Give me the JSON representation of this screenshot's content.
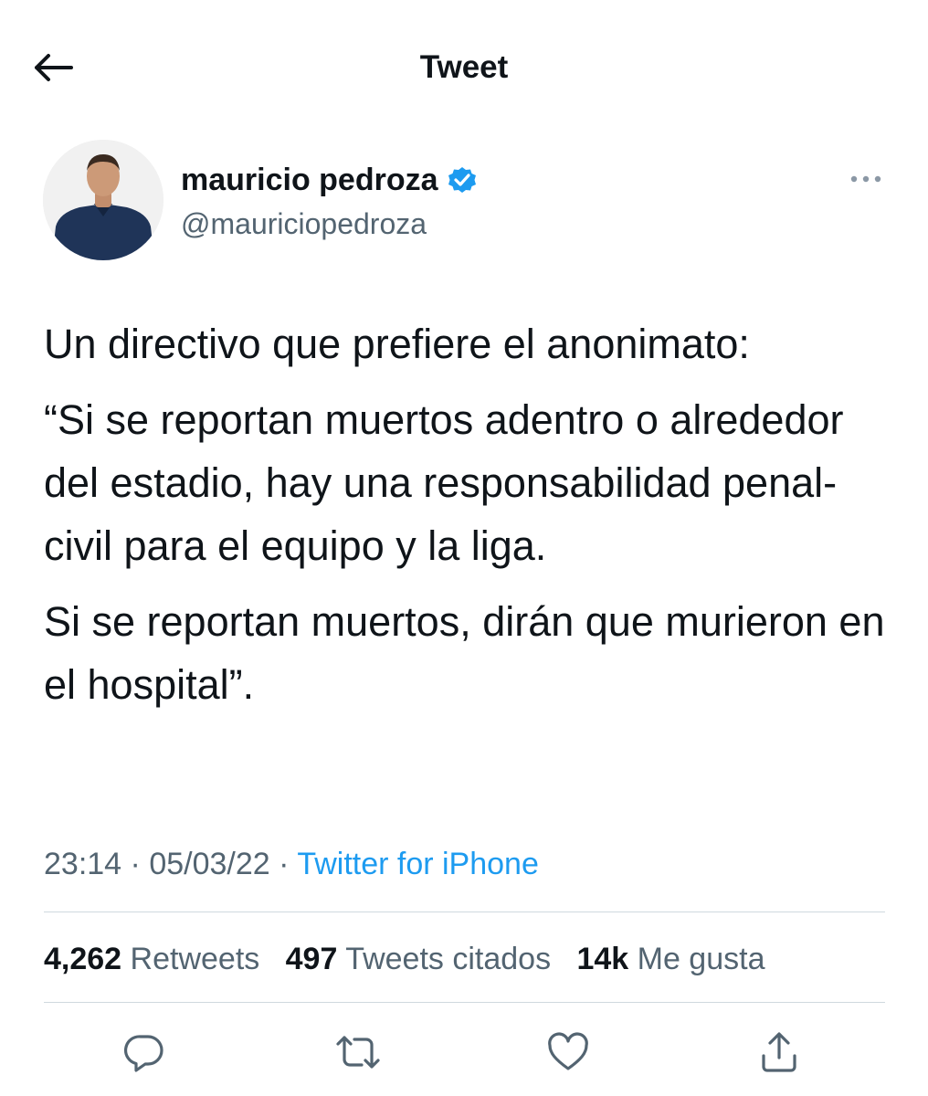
{
  "header": {
    "title": "Tweet"
  },
  "author": {
    "display_name": "mauricio pedroza",
    "handle": "@mauriciopedroza",
    "verified": true
  },
  "tweet": {
    "paragraphs": [
      "Un directivo que prefiere el anonimato:",
      "“Si se reportan muertos adentro o alrededor del estadio, hay una responsabilidad penal-civil para el equipo y la liga.",
      "Si se reportan muertos, dirán que murieron en el hospital”."
    ],
    "time": "23:14",
    "separator": "·",
    "date": "05/03/22",
    "source": "Twitter for iPhone"
  },
  "stats": {
    "retweets_count": "4,262",
    "retweets_label": "Retweets",
    "quotes_count": "497",
    "quotes_label": "Tweets citados",
    "likes_count": "14k",
    "likes_label": "Me gusta"
  },
  "colors": {
    "accent": "#1d9bf0",
    "text": "#0f1419",
    "secondary": "#536471",
    "divider": "#cfd9de"
  },
  "icons": {
    "back": "arrow-left-icon",
    "verified": "verified-badge-icon",
    "more": "more-horizontal-icon",
    "reply": "reply-icon",
    "retweet": "retweet-icon",
    "like": "heart-icon",
    "share": "share-icon"
  }
}
